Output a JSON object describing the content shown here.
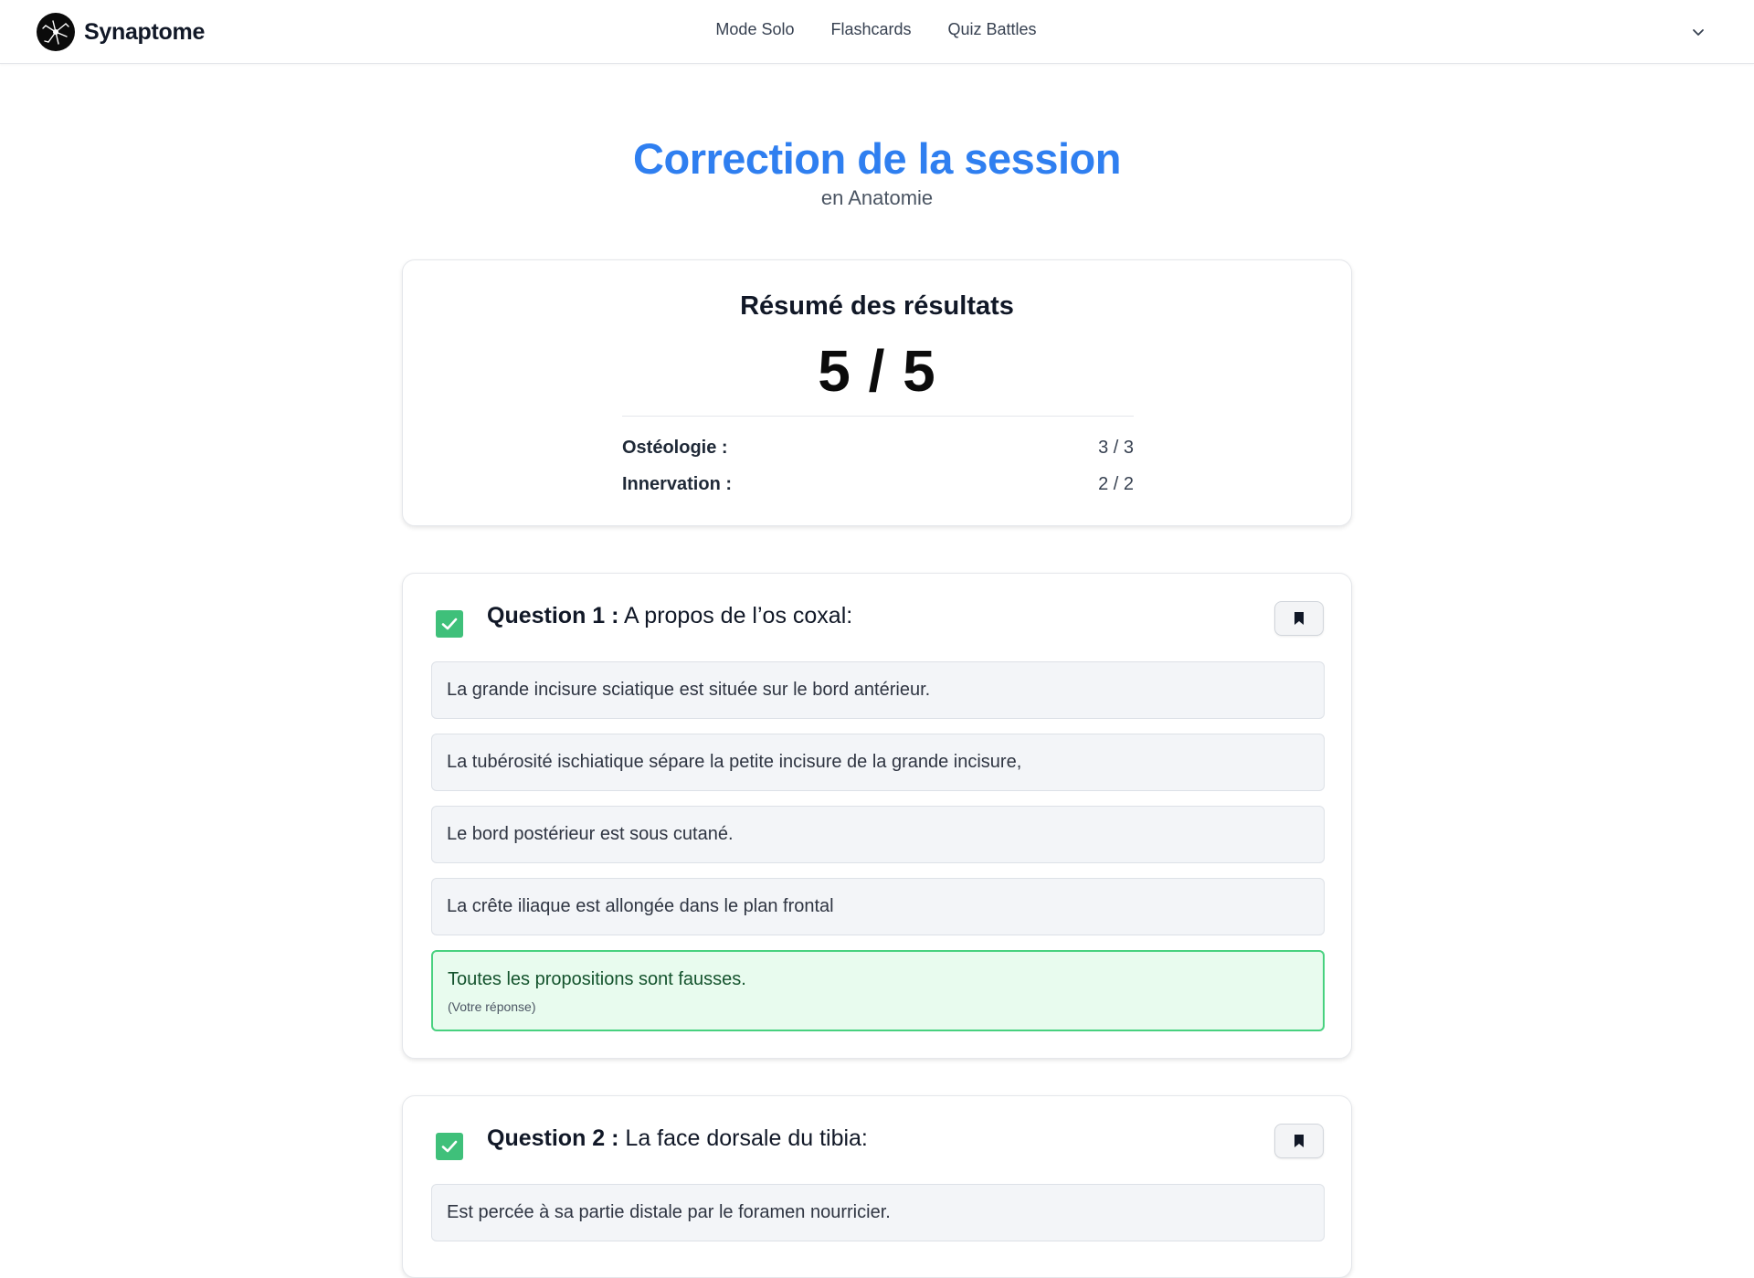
{
  "header": {
    "brand": "Synaptome",
    "nav": [
      "Mode Solo",
      "Flashcards",
      "Quiz Battles"
    ],
    "caret_icon": "chevron-down-icon"
  },
  "page": {
    "title": "Correction de la session",
    "subtitle": "en Anatomie"
  },
  "summary": {
    "title": "Résumé des résultats",
    "score": "5 / 5",
    "rows": [
      {
        "label": "Ostéologie :",
        "value": "3 / 3"
      },
      {
        "label": "Innervation :",
        "value": "2 / 2"
      }
    ]
  },
  "questions": [
    {
      "number": "Question 1 :",
      "text": "A propos de l’os coxal:",
      "status": "correct",
      "options": [
        "La grande incisure sciatique est située sur le bord antérieur.",
        "La tubérosité ischiatique sépare la petite incisure de la grande incisure,",
        "Le bord postérieur est sous cutané.",
        "La crête iliaque est allongée dans le plan frontal",
        "Toutes les propositions sont fausses."
      ],
      "your_answer_note": "(Votre réponse)"
    },
    {
      "number": "Question 2 :",
      "text": "La face dorsale du tibia:",
      "status": "correct",
      "options": [
        "Est percée à sa partie distale par le foramen nourricier."
      ]
    }
  ],
  "colors": {
    "title_blue": "#2f7ff0",
    "check_green": "#3fc07a",
    "correct_bg": "#e8fbee",
    "correct_border": "#48d17f"
  }
}
